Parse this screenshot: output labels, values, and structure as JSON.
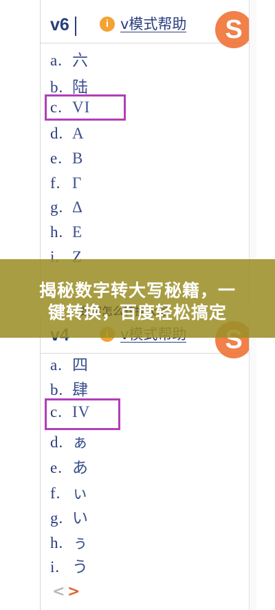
{
  "top_panel": {
    "input_text": "v6",
    "help_icon": "i",
    "help_link": "v模式帮助",
    "logo_letter": "S",
    "candidates": [
      {
        "index": "a.",
        "word": "六"
      },
      {
        "index": "b.",
        "word": "陆"
      },
      {
        "index": "c.",
        "word": "VI"
      },
      {
        "index": "d.",
        "word": "Α"
      },
      {
        "index": "e.",
        "word": "Β"
      },
      {
        "index": "f.",
        "word": "Γ"
      },
      {
        "index": "g.",
        "word": "Δ"
      },
      {
        "index": "h.",
        "word": "Ε"
      },
      {
        "index": "i.",
        "word": "Ζ"
      }
    ]
  },
  "headline": {
    "line1": "揭秘数字转大写秘籍，一",
    "line2": "键转换，百度轻松搞定"
  },
  "bottom_panel": {
    "input_text": "v4",
    "ghost_text": "数字怎么转换大写",
    "help_icon": "i",
    "help_link": "v模式帮助",
    "logo_letter": "S",
    "candidates": [
      {
        "index": "a.",
        "word": "四"
      },
      {
        "index": "b.",
        "word": "肆"
      },
      {
        "index": "c.",
        "word": "IV"
      },
      {
        "index": "d.",
        "word": "ぁ"
      },
      {
        "index": "e.",
        "word": "あ"
      },
      {
        "index": "f.",
        "word": "ぃ"
      },
      {
        "index": "g.",
        "word": "い"
      },
      {
        "index": "h.",
        "word": "ぅ"
      },
      {
        "index": "i.",
        "word": "う"
      }
    ],
    "prev": "<",
    "next": ">"
  },
  "colors": {
    "text": "#2a3d7c",
    "highlight": "#b13fb7",
    "overlay": "#9c9028",
    "logo": "#ef6a2a"
  }
}
